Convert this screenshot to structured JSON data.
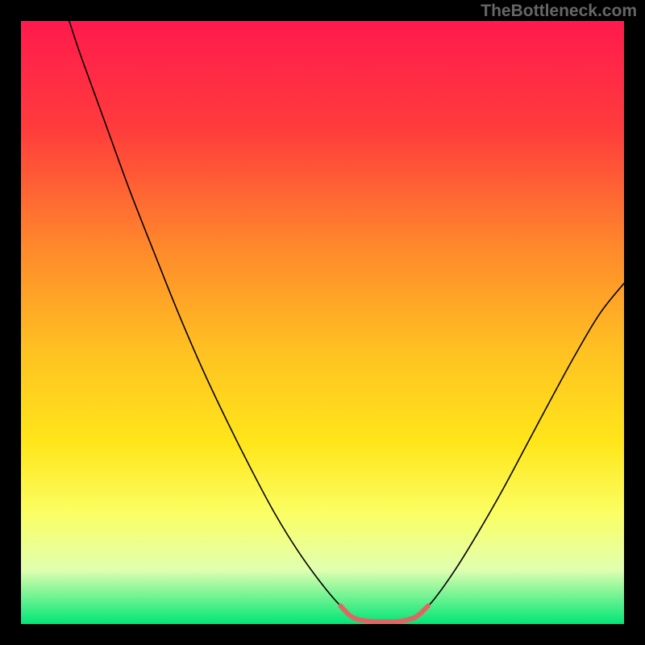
{
  "watermark": "TheBottleneck.com",
  "chart_data": {
    "type": "line",
    "title": "",
    "xlabel": "",
    "ylabel": "",
    "xlim": [
      0,
      100
    ],
    "ylim": [
      0,
      100
    ],
    "background_gradient_stops": [
      {
        "offset": 0,
        "color": "#ff1a4d"
      },
      {
        "offset": 18,
        "color": "#ff3c3c"
      },
      {
        "offset": 38,
        "color": "#ff8a2b"
      },
      {
        "offset": 55,
        "color": "#ffc222"
      },
      {
        "offset": 70,
        "color": "#ffe61a"
      },
      {
        "offset": 82,
        "color": "#fbff66"
      },
      {
        "offset": 91,
        "color": "#e0ffb0"
      },
      {
        "offset": 100,
        "color": "#00e676"
      }
    ],
    "series": [
      {
        "name": "left-branch",
        "color": "#000000",
        "width": 1.6,
        "points": [
          {
            "x": 8.0,
            "y": 100.0
          },
          {
            "x": 10.0,
            "y": 94.0
          },
          {
            "x": 14.0,
            "y": 83.0
          },
          {
            "x": 18.0,
            "y": 72.0
          },
          {
            "x": 22.0,
            "y": 61.8
          },
          {
            "x": 26.0,
            "y": 51.8
          },
          {
            "x": 30.0,
            "y": 42.5
          },
          {
            "x": 34.0,
            "y": 34.0
          },
          {
            "x": 38.0,
            "y": 26.0
          },
          {
            "x": 42.0,
            "y": 18.5
          },
          {
            "x": 46.0,
            "y": 12.0
          },
          {
            "x": 50.0,
            "y": 6.5
          },
          {
            "x": 53.0,
            "y": 3.0
          },
          {
            "x": 55.0,
            "y": 1.4
          },
          {
            "x": 57.5,
            "y": 0.7
          },
          {
            "x": 60.0,
            "y": 0.6
          },
          {
            "x": 63.0,
            "y": 0.7
          }
        ]
      },
      {
        "name": "right-branch",
        "color": "#000000",
        "width": 1.6,
        "points": [
          {
            "x": 63.0,
            "y": 0.7
          },
          {
            "x": 65.5,
            "y": 1.5
          },
          {
            "x": 68.0,
            "y": 3.5
          },
          {
            "x": 72.0,
            "y": 9.0
          },
          {
            "x": 76.0,
            "y": 15.5
          },
          {
            "x": 80.0,
            "y": 22.5
          },
          {
            "x": 84.0,
            "y": 30.0
          },
          {
            "x": 88.0,
            "y": 37.5
          },
          {
            "x": 92.0,
            "y": 44.8
          },
          {
            "x": 96.0,
            "y": 51.5
          },
          {
            "x": 100.0,
            "y": 56.5
          }
        ]
      },
      {
        "name": "bottom-highlight",
        "color": "#e06666",
        "width": 6.0,
        "points": [
          {
            "x": 53.0,
            "y": 3.0
          },
          {
            "x": 55.0,
            "y": 1.1
          },
          {
            "x": 57.5,
            "y": 0.5
          },
          {
            "x": 60.0,
            "y": 0.4
          },
          {
            "x": 63.0,
            "y": 0.5
          },
          {
            "x": 65.5,
            "y": 1.2
          },
          {
            "x": 67.5,
            "y": 3.0
          }
        ]
      }
    ]
  }
}
